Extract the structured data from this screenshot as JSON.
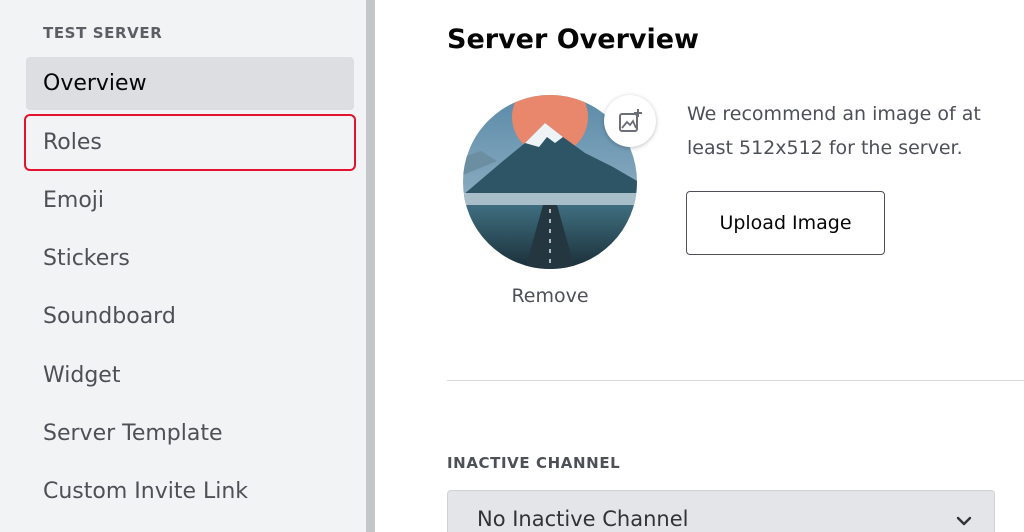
{
  "sidebar": {
    "header": "TEST SERVER",
    "items": [
      {
        "label": "Overview",
        "state": "selected"
      },
      {
        "label": "Roles",
        "state": "highlighted"
      },
      {
        "label": "Emoji"
      },
      {
        "label": "Stickers"
      },
      {
        "label": "Soundboard"
      },
      {
        "label": "Widget"
      },
      {
        "label": "Server Template"
      },
      {
        "label": "Custom Invite Link"
      }
    ]
  },
  "main": {
    "title": "Server Overview",
    "avatar": {
      "icon": "mountain-landscape-image",
      "add_icon": "add-image-icon",
      "remove_label": "Remove"
    },
    "recommendation": "We recommend an image of at least 512x512 for the server.",
    "upload_label": "Upload Image",
    "inactive_channel": {
      "label": "INACTIVE CHANNEL",
      "selected": "No Inactive Channel",
      "icon": "chevron-down-icon"
    }
  },
  "colors": {
    "sidebar_bg": "#f2f3f5",
    "selected_bg": "#dcdee2",
    "highlight_outline": "#e4112f",
    "text_primary": "#060607",
    "text_secondary": "#4e5058"
  }
}
